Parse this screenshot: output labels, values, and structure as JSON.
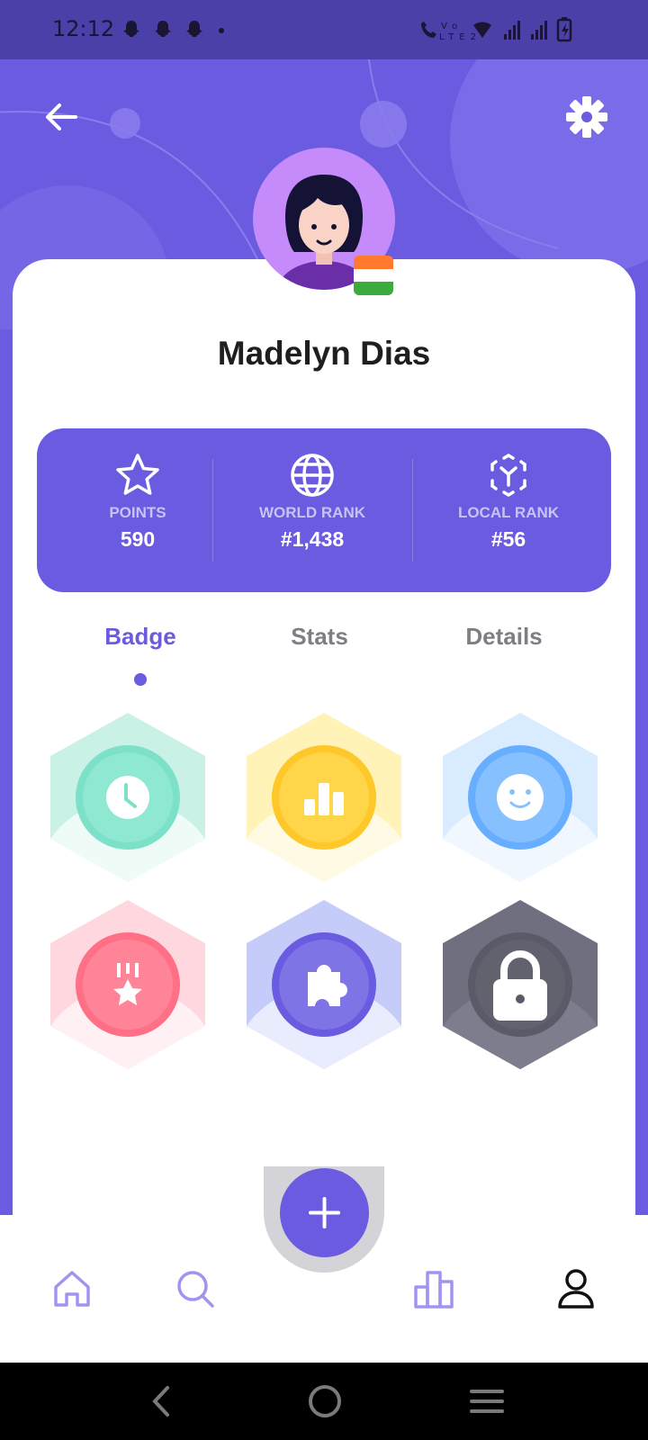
{
  "status_bar": {
    "time": "12:12",
    "left_icons": "👻 👻 👻 •",
    "right_icons": "📞 Vo LTE2 ᯤ ▂▄▆ ▂▄▆ 🔋"
  },
  "profile": {
    "name": "Madelyn Dias",
    "country_flag": "India"
  },
  "stats": [
    {
      "icon": "star-icon",
      "label": "POINTS",
      "value": "590"
    },
    {
      "icon": "globe-icon",
      "label": "WORLD RANK",
      "value": "#1,438"
    },
    {
      "icon": "local-rank-icon",
      "label": "LOCAL RANK",
      "value": "#56"
    }
  ],
  "tabs": [
    {
      "label": "Badge",
      "active": true
    },
    {
      "label": "Stats",
      "active": false
    },
    {
      "label": "Details",
      "active": false
    }
  ],
  "badges": [
    {
      "icon": "clock-icon",
      "color": "#6EDDC4",
      "locked": false
    },
    {
      "icon": "bar-chart-icon",
      "color": "#FFC93A",
      "locked": false
    },
    {
      "icon": "smiley-icon",
      "color": "#79BAFF",
      "locked": false
    },
    {
      "icon": "medal-icon",
      "color": "#FF6F86",
      "locked": false
    },
    {
      "icon": "puzzle-icon",
      "color": "#6B5BE0",
      "locked": false
    },
    {
      "icon": "lock-icon",
      "color": "#6F6F80",
      "locked": true
    }
  ],
  "nav": [
    "home-icon",
    "search-icon",
    "add-icon",
    "leaderboard-icon",
    "profile-icon"
  ],
  "colors": {
    "accent": "#6B5BE0",
    "status_bar": "#4B3FA8",
    "tab_inactive": "#7E7E84"
  }
}
